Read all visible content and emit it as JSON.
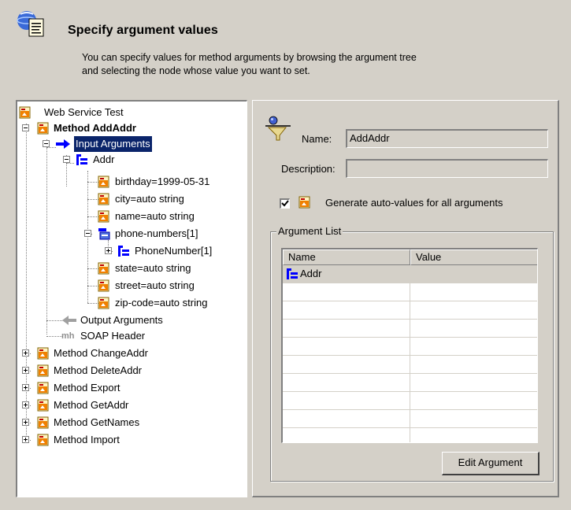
{
  "header": {
    "title": "Specify argument values",
    "description_line1": "You can specify values for method arguments by browsing the argument tree",
    "description_line2": "and selecting the node whose value you want to set."
  },
  "tree": {
    "root": "Web Service Test",
    "method_addaddr": "Method AddAddr",
    "input_arguments": "Input Arguments",
    "addr": "Addr",
    "birthday": "birthday=1999-05-31",
    "city": "city=auto string",
    "name": "name=auto string",
    "phone_numbers": "phone-numbers[1]",
    "phone_number": "PhoneNumber[1]",
    "state": "state=auto string",
    "street": "street=auto string",
    "zip_code": "zip-code=auto string",
    "output_arguments": "Output Arguments",
    "soap_header": "SOAP Header",
    "soap_badge": "mh",
    "method_changeaddr": "Method ChangeAddr",
    "method_deleteaddr": "Method DeleteAddr",
    "method_export": "Method Export",
    "method_getaddr": "Method GetAddr",
    "method_getnames": "Method GetNames",
    "method_import": "Method Import"
  },
  "details": {
    "name_label": "Name:",
    "name_value": "AddAddr",
    "description_label": "Description:",
    "description_value": "",
    "generate_label": "Generate auto-values for all arguments",
    "generate_checked": true,
    "argument_list_label": "Argument List",
    "columns": [
      "Name",
      "Value"
    ],
    "rows": [
      {
        "name": "Addr",
        "value": ""
      }
    ],
    "edit_button": "Edit Argument"
  },
  "colors": {
    "selection": "#0a246a",
    "window": "#d4d0c8",
    "icon_blue": "#0000ff",
    "doc_orange": "#f08000"
  }
}
